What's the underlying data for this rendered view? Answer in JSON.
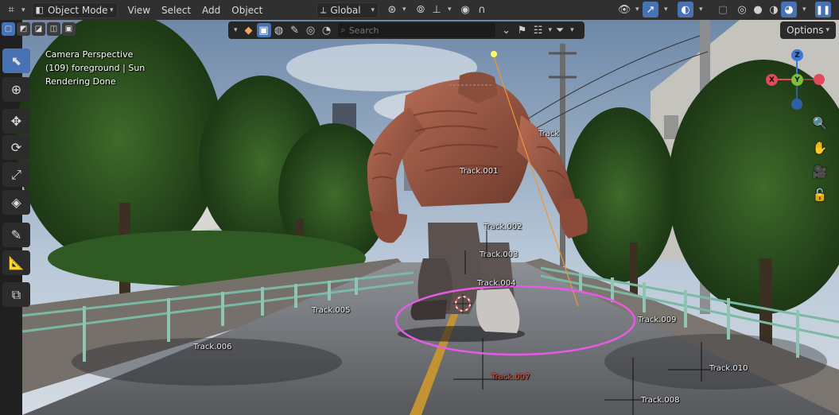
{
  "header": {
    "mode_label": "Object Mode",
    "menus": [
      "View",
      "Select",
      "Add",
      "Object"
    ],
    "orientation_label": "Global"
  },
  "filterbar": {
    "search_placeholder": "Search"
  },
  "options_label": "Options",
  "viewport_info": {
    "line1": "Camera Perspective",
    "line2": "(109) foreground | Sun",
    "line3": "Rendering Done"
  },
  "tracks": [
    {
      "label": "Track",
      "highlighted": false
    },
    {
      "label": "Track.001",
      "highlighted": false
    },
    {
      "label": "Track.002",
      "highlighted": false
    },
    {
      "label": "Track.003",
      "highlighted": false
    },
    {
      "label": "Track.004",
      "highlighted": false
    },
    {
      "label": "Track.005",
      "highlighted": false
    },
    {
      "label": "Track.006",
      "highlighted": false
    },
    {
      "label": "Track.007",
      "highlighted": true
    },
    {
      "label": "Track.008",
      "highlighted": false
    },
    {
      "label": "Track.009",
      "highlighted": false
    },
    {
      "label": "Track.010",
      "highlighted": false
    }
  ],
  "gizmo": {
    "z": "Z",
    "x": "X",
    "y": "Y"
  },
  "tools": [
    "select-box-tool",
    "cursor-tool",
    "move-tool",
    "rotate-tool",
    "scale-tool",
    "transform-tool",
    "annotate-tool",
    "measure-tool",
    "add-cube-tool"
  ],
  "colors": {
    "accent": "#4772b3",
    "selection_ring": "#e75ae5",
    "track_highlight": "#e0533a"
  }
}
